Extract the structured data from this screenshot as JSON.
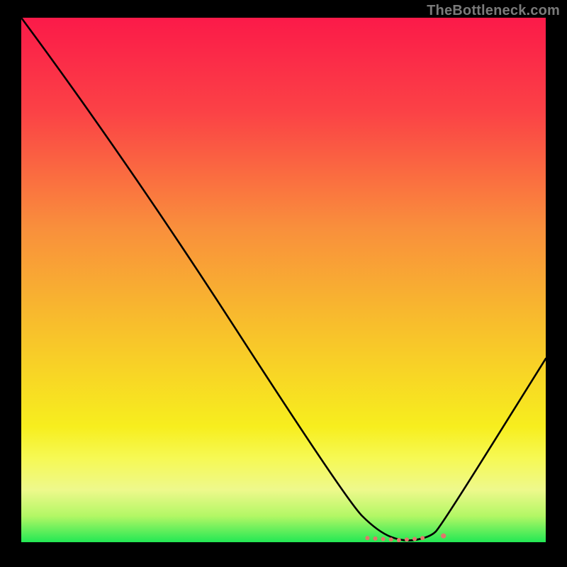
{
  "watermark": "TheBottleneck.com",
  "chart_data": {
    "type": "line",
    "title": "",
    "xlabel": "",
    "ylabel": "",
    "xlim": [
      0,
      100
    ],
    "ylim": [
      0,
      100
    ],
    "series": [
      {
        "name": "bottleneck-curve",
        "x": [
          0,
          20,
          62,
          68,
          73,
          78,
          80,
          100
        ],
        "values": [
          100,
          73,
          8,
          2,
          0,
          1,
          3,
          35
        ]
      }
    ],
    "markers": {
      "name": "minimum-cluster",
      "x": [
        66,
        67.5,
        69,
        70.5,
        72,
        73.5,
        75,
        76.5,
        80.5
      ],
      "values": [
        0.8,
        0.7,
        0.6,
        0.5,
        0.4,
        0.5,
        0.6,
        0.8,
        1.2
      ],
      "color": "#e1776b"
    },
    "background_gradient": {
      "stops": [
        {
          "offset": 0.0,
          "color": "#fb1a49"
        },
        {
          "offset": 0.18,
          "color": "#fb4246"
        },
        {
          "offset": 0.4,
          "color": "#f98f3c"
        },
        {
          "offset": 0.6,
          "color": "#f8c22b"
        },
        {
          "offset": 0.78,
          "color": "#f7ee1e"
        },
        {
          "offset": 0.84,
          "color": "#f6f954"
        },
        {
          "offset": 0.9,
          "color": "#eef98c"
        },
        {
          "offset": 0.95,
          "color": "#b3f765"
        },
        {
          "offset": 1.0,
          "color": "#22e854"
        }
      ]
    }
  }
}
